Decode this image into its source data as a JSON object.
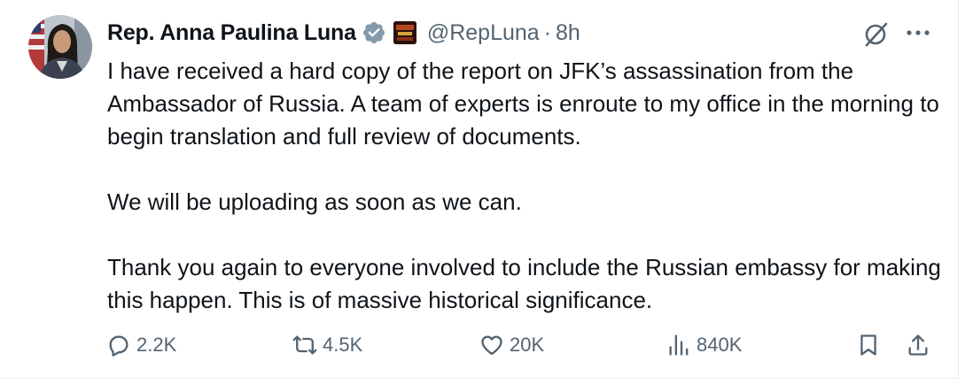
{
  "tweet": {
    "author_name": "Rep. Anna Paulina Luna",
    "handle": "@RepLuna",
    "separator": "·",
    "time": "8h",
    "paragraphs": [
      "I have received a hard copy of the report on JFK’s assassination from the Ambassador of Russia. A team of experts is enroute to my office in the morning to begin translation and full review of documents.",
      "We will be uploading as soon as we can.",
      "Thank you again to everyone involved to include the Russian embassy for making this happen. This is of massive historical significance."
    ]
  },
  "icons": {
    "avatar": "profile-photo",
    "verified": "verified-badge-icon",
    "affiliation": "affiliation-badge-icon",
    "grok": "grok-icon",
    "more": "more-icon",
    "reply": "reply-icon",
    "retweet": "retweet-icon",
    "like": "like-icon",
    "views": "views-icon",
    "bookmark": "bookmark-icon",
    "share": "share-icon"
  },
  "actions": {
    "replies": "2.2K",
    "retweets": "4.5K",
    "likes": "20K",
    "views": "840K"
  },
  "colors": {
    "text": "#0f1419",
    "secondary": "#536471",
    "verified_badge": "#829aab",
    "border": "#e6ecf0"
  }
}
